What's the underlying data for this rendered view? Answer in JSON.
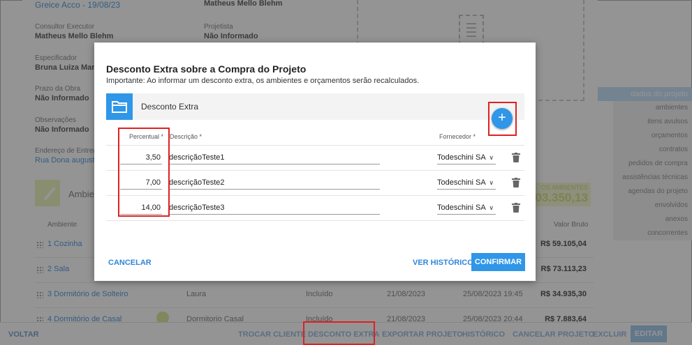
{
  "background": {
    "header_link": "Greice Acco - 19/08/23",
    "header_right": "Matheus Mello Blehm",
    "fields": [
      {
        "label": "Consultor Executor",
        "value": "Matheus Mello Blehm"
      },
      {
        "label": "Projetista",
        "value": "Não Informado"
      },
      {
        "label": "Especificador",
        "value": "Bruna Luiza Marc"
      },
      {
        "label": "Prazo da Obra",
        "value": "Não Informado"
      },
      {
        "label": "Observações",
        "value": "Não Informado"
      },
      {
        "label": "Endereço de Entreg",
        "value": "Rua Dona augusta"
      }
    ],
    "sidenav": [
      "dados do projeto",
      "ambientes",
      "itens avulsos",
      "orçamentos",
      "contratos",
      "pedidos de compra",
      "assistências técnicas",
      "agendas do projeto",
      "envolvidos",
      "anexos",
      "concorrentes"
    ],
    "ambientes_title": "Ambie",
    "total_label": "OS AMBIENTES",
    "total_value": "03.350,13",
    "columns": {
      "ambiente": "Ambiente",
      "valor_bruto": "Valor Bruto"
    },
    "rows": [
      {
        "name": "1 Cozinha",
        "price": "R$ 59.105,04",
        "responsavel": "",
        "status": "",
        "data1": "",
        "data2": ""
      },
      {
        "name": "2 Sala",
        "price": "R$ 73.113,23",
        "responsavel": "",
        "status": "",
        "data1": "",
        "data2": ""
      },
      {
        "name": "3 Dormitório de Solteiro",
        "price": "R$ 34.935,30",
        "responsavel": "Laura",
        "status": "Incluído",
        "data1": "21/08/2023",
        "data2": "25/08/2023 19:45"
      },
      {
        "name": "4 Dormitório de Casal",
        "price": "R$ 7.883,64",
        "responsavel": "Dormitorio Casal",
        "status": "Incluído",
        "data1": "21/08/2023",
        "data2": "25/08/2023 20:44"
      }
    ]
  },
  "footer": {
    "voltar": "VOLTAR",
    "trocar_cliente": "TROCAR CLIENTE",
    "desconto_extra": "DESCONTO EXTRA",
    "exportar": "EXPORTAR PROJETO",
    "historico": "HISTÓRICO",
    "cancelar_projeto": "CANCELAR PROJETO",
    "excluir": "EXCLUIR",
    "editar": "EDITAR"
  },
  "modal": {
    "title": "Desconto Extra sobre a Compra do Projeto",
    "subtitle": "Importante: Ao informar um desconto extra, os ambientes e orçamentos serão recalculados.",
    "panel_title": "Desconto Extra",
    "add_label": "+",
    "headers": {
      "percentual": "Percentual *",
      "descricao": "Descrição *",
      "fornecedor": "Fornecedor *"
    },
    "discounts": [
      {
        "percentual": "3,50",
        "descricao": "descriçãoTeste1",
        "fornecedor": "Todeschini SA"
      },
      {
        "percentual": "7,00",
        "descricao": "descriçãoTeste2",
        "fornecedor": "Todeschini SA"
      },
      {
        "percentual": "14,00",
        "descricao": "descriçãoTeste3",
        "fornecedor": "Todeschini SA"
      }
    ],
    "cancel": "CANCELAR",
    "history": "VER HISTÓRICO",
    "confirm": "CONFIRMAR"
  },
  "colors": {
    "accent": "#2f96e8",
    "highlight": "#e02020"
  }
}
